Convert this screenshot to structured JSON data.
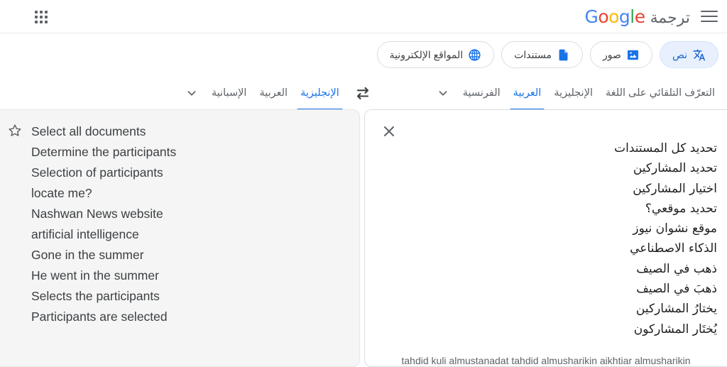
{
  "header": {
    "apps_icon": "apps-grid-icon",
    "brand_product": "ترجمة",
    "brand_name": "Google",
    "brand_letters": [
      "G",
      "o",
      "o",
      "g",
      "l",
      "e"
    ],
    "menu_icon": "hamburger-menu-icon"
  },
  "mode_tabs": [
    {
      "label": "نص",
      "icon": "translate-text-icon",
      "active": true
    },
    {
      "label": "صور",
      "icon": "image-icon",
      "active": false
    },
    {
      "label": "مستندات",
      "icon": "document-icon",
      "active": false
    },
    {
      "label": "المواقع الإلكترونية",
      "icon": "globe-icon",
      "active": false
    }
  ],
  "source_languages": {
    "items": [
      {
        "label": "التعرّف التلقائي على اللغة",
        "active": false
      },
      {
        "label": "الإنجليزية",
        "active": false
      },
      {
        "label": "العربية",
        "active": true
      },
      {
        "label": "الفرنسية",
        "active": false
      }
    ],
    "more_icon": "chevron-down-icon"
  },
  "target_languages": {
    "items": [
      {
        "label": "الإنجليزية",
        "active": true
      },
      {
        "label": "العربية",
        "active": false
      },
      {
        "label": "الإسبانية",
        "active": false
      }
    ],
    "more_icon": "chevron-down-icon"
  },
  "swap_icon": "swap-languages-icon",
  "source_panel": {
    "close_icon": "close-icon",
    "lines": [
      "تحديد كل المستندات",
      "تحديد المشاركين",
      "اختيار المشاركين",
      "تحديد موقعي؟",
      "موقع نشوان نيوز",
      "الذكاء الاصطناعي",
      "ذهب في الصيف",
      "ذهبَ في الصيف",
      "يختارُ المشاركين",
      "يُختَار المشاركون"
    ],
    "transliteration": "tahdid kuli almustanadat tahdid almusharikin aikhtiar almusharikin"
  },
  "target_panel": {
    "star_icon": "star-outline-icon",
    "lines": [
      "Select all documents",
      "Determine the participants",
      "Selection of participants",
      "locate me?",
      "Nashwan News website",
      "artificial intelligence",
      "Gone in the summer",
      "He went in the summer",
      "Selects the participants",
      "Participants are selected"
    ]
  },
  "colors": {
    "accent": "#1a73e8",
    "accent_bg": "#e8f0fe",
    "panel_bg": "#f5f5f5",
    "text": "#202124",
    "muted": "#5f6368"
  }
}
